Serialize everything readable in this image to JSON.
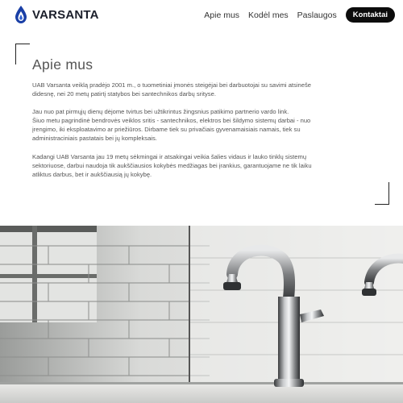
{
  "brand": {
    "name": "VARSANTA",
    "logo_icon": "water-drops-logo",
    "logo_color": "#1a3fa6"
  },
  "nav": {
    "items": [
      "Apie mus",
      "Kodėl mes",
      "Paslaugos"
    ],
    "cta_label": "Kontaktai"
  },
  "about": {
    "title": "Apie mus",
    "paragraphs": [
      [
        "UAB Varsanta veiklą pradėjo 2001 m., o tuometiniai įmonės steigėjai bei darbuotojai su savimi atsineše",
        "didesnę, nei 20 metų patirtį statybos bei santechnikos darbų srityse."
      ],
      [
        "Jau nuo pat pirmųjų dienų dėjome tvirtus bei užtikrintus žingsnius patikimo partnerio vardo link.",
        "Šiuo metu pagrindinė bendrovės veiklos sritis - santechnikos, elektros bei šildymo sistemų darbai - nuo",
        "įrengimo, iki eksploatavimo ar priežiūros. Dirbame tiek su privačiais gyvenamaisiais namais, tiek su",
        "administraciniais pastatais bei jų kompleksais."
      ],
      [
        "Kadangi UAB Varsanta jau 19 metų sėkmingai ir atsakingai veikia šalies vidaus ir lauko tinklų sistemų",
        "sektoriuose, darbui naudoja tik aukščiausios kokybės medžiagas bei įrankius, garantuojame ne tik laiku",
        "atliktus darbus, bet ir aukščiausią jų kokybę."
      ]
    ]
  },
  "photo": {
    "subject": "chrome-faucets-photo"
  }
}
